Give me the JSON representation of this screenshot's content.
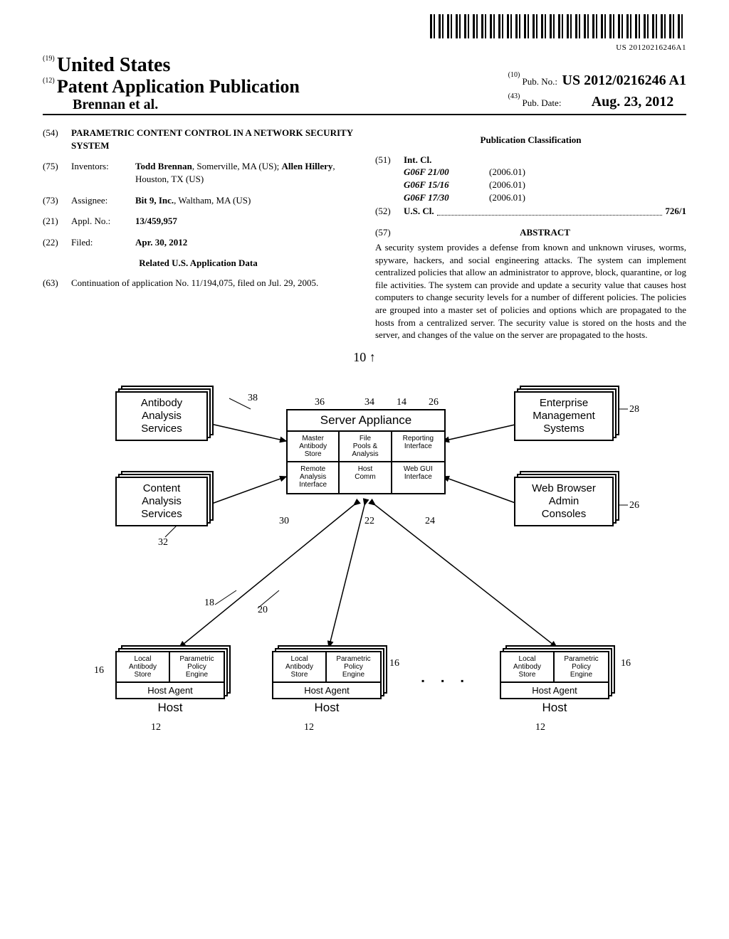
{
  "barcode_label": "US 20120216246A1",
  "header": {
    "country_code": "(19)",
    "country": "United States",
    "pubtype_code": "(12)",
    "pubtype": "Patent Application Publication",
    "author_line": "Brennan et al.",
    "pubno_code": "(10)",
    "pubno_label": "Pub. No.:",
    "pubno": "US 2012/0216246 A1",
    "pubdate_code": "(43)",
    "pubdate_label": "Pub. Date:",
    "pubdate": "Aug. 23, 2012"
  },
  "left": {
    "c54": "(54)",
    "title": "PARAMETRIC CONTENT CONTROL IN A NETWORK SECURITY SYSTEM",
    "c75": "(75)",
    "inventors_label": "Inventors:",
    "inventors": "Todd Brennan, Somerville, MA (US); Allen Hillery, Houston, TX (US)",
    "inventors_b1": "Todd Brennan",
    "inventors_p1": ", Somerville, MA (US); ",
    "inventors_b2": "Allen Hillery",
    "inventors_p2": ", Houston, TX (US)",
    "c73": "(73)",
    "assignee_label": "Assignee:",
    "assignee_b": "Bit 9, Inc.",
    "assignee_p": ", Waltham, MA (US)",
    "c21": "(21)",
    "appl_label": "Appl. No.:",
    "appl": "13/459,957",
    "c22": "(22)",
    "filed_label": "Filed:",
    "filed": "Apr. 30, 2012",
    "related_head": "Related U.S. Application Data",
    "c63": "(63)",
    "related": "Continuation of application No. 11/194,075, filed on Jul. 29, 2005."
  },
  "right": {
    "pubclass_head": "Publication Classification",
    "c51": "(51)",
    "intcl_label": "Int. Cl.",
    "intcl": [
      {
        "a": "G06F 21/00",
        "b": "(2006.01)"
      },
      {
        "a": "G06F 15/16",
        "b": "(2006.01)"
      },
      {
        "a": "G06F 17/30",
        "b": "(2006.01)"
      }
    ],
    "c52": "(52)",
    "uscl_label": "U.S. Cl.",
    "uscl_val": "726/1",
    "c57": "(57)",
    "abstract_head": "ABSTRACT",
    "abstract": "A security system provides a defense from known and unknown viruses, worms, spyware, hackers, and social engineering attacks. The system can implement centralized policies that allow an administrator to approve, block, quarantine, or log file activities. The system can provide and update a security value that causes host computers to change security levels for a number of different policies. The policies are grouped into a master set of policies and options which are propagated to the hosts from a centralized server. The security value is stored on the hosts and the server, and changes of the value on the server are propagated to the hosts."
  },
  "fig": {
    "top_ref": "10",
    "antibody": "Antibody\nAnalysis\nServices",
    "content": "Content\nAnalysis\nServices",
    "enterprise": "Enterprise\nManagement\nSystems",
    "browser": "Web Browser\nAdmin\nConsoles",
    "server_title": "Server Appliance",
    "server_cells": [
      "Master\nAntibody\nStore",
      "File\nPools &\nAnalysis",
      "Reporting\nInterface",
      "Remote\nAnalysis\nInterface",
      "Host\nComm",
      "Web GUI\nInterface"
    ],
    "host_cells": [
      "Local\nAntibody\nStore",
      "Parametric\nPolicy\nEngine"
    ],
    "host_agent_label": "Host Agent",
    "host_label": "Host",
    "refs": {
      "r38": "38",
      "r36": "36",
      "r34": "34",
      "r14": "14",
      "r26a": "26",
      "r28": "28",
      "r26b": "26",
      "r32": "32",
      "r30": "30",
      "r22": "22",
      "r24": "24",
      "r18": "18",
      "r20": "20",
      "r16a": "16",
      "r16b": "16",
      "r16c": "16",
      "r12a": "12",
      "r12b": "12",
      "r12c": "12"
    }
  }
}
